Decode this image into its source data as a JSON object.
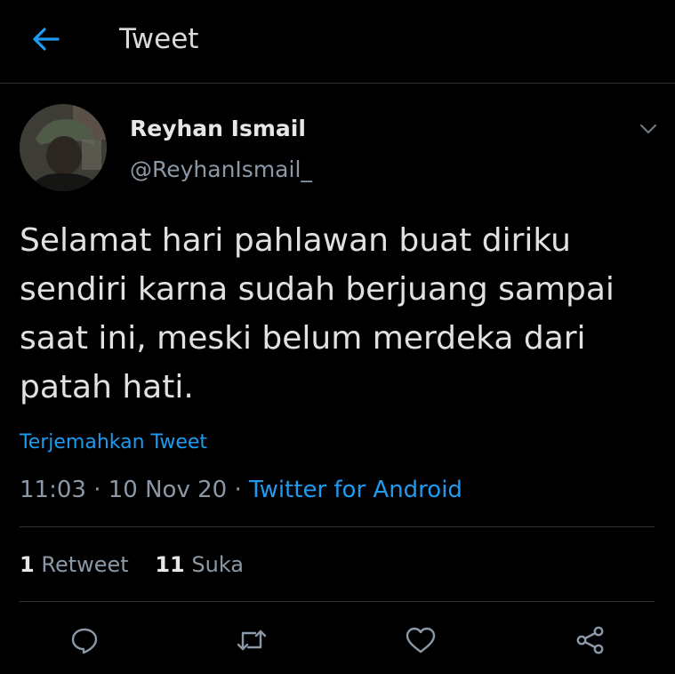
{
  "header": {
    "title": "Tweet",
    "back_icon": "arrow-left-icon"
  },
  "colors": {
    "accent": "#1d9bf0",
    "background": "#000000",
    "muted": "#8b98a5",
    "text": "#e1e1e1",
    "divider": "#2f3336"
  },
  "tweet": {
    "author_name": "Reyhan Ismail",
    "author_handle": "@ReyhanIsmail_",
    "text": "Selamat hari pahlawan buat diriku sendiri karna sudah berjuang sampai saat ini, meski belum merdeka dari patah hati.",
    "translate_label": "Terjemahkan Tweet",
    "time": "11:03",
    "date": "10 Nov 20",
    "separator": "·",
    "source": "Twitter for Android"
  },
  "stats": {
    "retweets_count": "1",
    "retweets_label": "Retweet",
    "likes_count": "11",
    "likes_label": "Suka"
  },
  "actions": [
    "reply-icon",
    "retweet-icon",
    "like-icon",
    "share-icon"
  ]
}
